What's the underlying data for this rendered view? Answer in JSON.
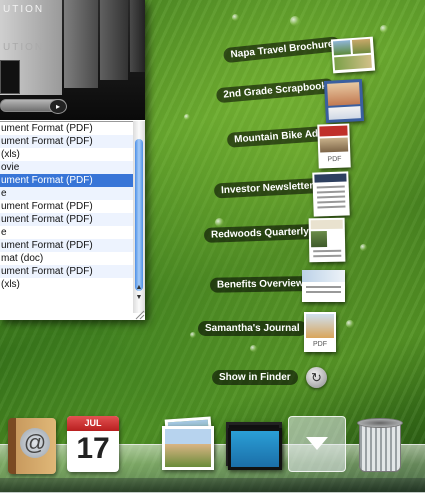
{
  "finder": {
    "coverflow_text_top": "UTION",
    "coverflow_text_bottom": "UTION",
    "files": [
      {
        "label": "ument Format (PDF)",
        "selected": false
      },
      {
        "label": "ument Format (PDF)",
        "selected": false
      },
      {
        "label": "(xls)",
        "selected": false
      },
      {
        "label": "ovie",
        "selected": false
      },
      {
        "label": "ument Format (PDF)",
        "selected": true
      },
      {
        "label": "e",
        "selected": false
      },
      {
        "label": "ument Format (PDF)",
        "selected": false
      },
      {
        "label": "ument Format (PDF)",
        "selected": false
      },
      {
        "label": "e",
        "selected": false
      },
      {
        "label": "ument Format (PDF)",
        "selected": false
      },
      {
        "label": "mat (doc)",
        "selected": false
      },
      {
        "label": "ument Format (PDF)",
        "selected": false
      },
      {
        "label": "(xls)",
        "selected": false
      }
    ],
    "scroll_up_icon": "triangle-up-icon",
    "scroll_down_icon": "triangle-down-icon"
  },
  "stack": {
    "items": [
      {
        "label": "Napa Travel Brochure"
      },
      {
        "label": "2nd Grade Scrapbook"
      },
      {
        "label": "Mountain Bike Ad",
        "tag": "PDF"
      },
      {
        "label": "Investor Newsletter"
      },
      {
        "label": "Redwoods Quarterly"
      },
      {
        "label": "Benefits Overview"
      },
      {
        "label": "Samantha's Journal",
        "tag": "PDF"
      }
    ],
    "show_in_finder": "Show in Finder",
    "finder_arrow_icon": "curved-arrow-icon"
  },
  "dock": {
    "calendar_month": "JUL",
    "calendar_day": "17",
    "icons": [
      "address-book-icon",
      "ical-icon",
      "pictures-stack-icon",
      "movies-stack-icon",
      "documents-stack-icon",
      "trash-icon"
    ]
  },
  "colors": {
    "selection": "#3875d7",
    "alt_row": "#edf3fe",
    "wallpaper": "#4d8c22"
  }
}
